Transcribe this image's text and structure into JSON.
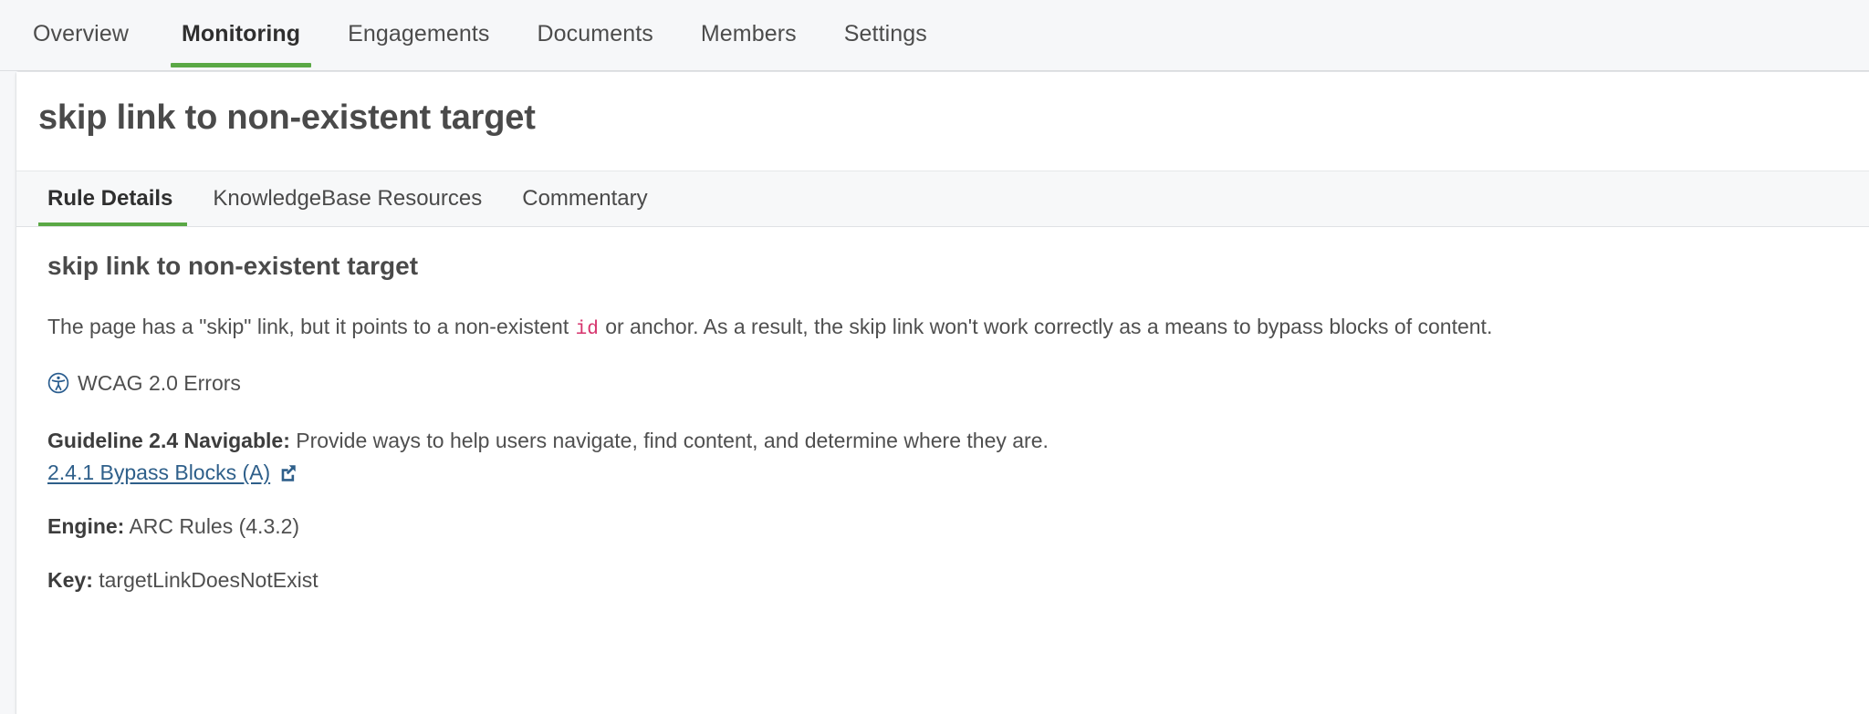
{
  "top_nav": {
    "tabs": [
      {
        "label": "Overview",
        "active": false
      },
      {
        "label": "Monitoring",
        "active": true
      },
      {
        "label": "Engagements",
        "active": false
      },
      {
        "label": "Documents",
        "active": false
      },
      {
        "label": "Members",
        "active": false
      },
      {
        "label": "Settings",
        "active": false
      }
    ]
  },
  "card": {
    "title": "skip link to non-existent target",
    "tabs": [
      {
        "label": "Rule Details",
        "active": true
      },
      {
        "label": "KnowledgeBase Resources",
        "active": false
      },
      {
        "label": "Commentary",
        "active": false
      }
    ]
  },
  "rule": {
    "name": "skip link to non-existent target",
    "description_before_code": "The page has a \"skip\" link, but it points to a non-existent ",
    "description_code": "id",
    "description_after_code": " or anchor. As a result, the skip link won't work correctly as a means to bypass blocks of content.",
    "standard_icon": "accessibility-icon",
    "standard_label": "WCAG 2.0 Errors",
    "guideline_label": "Guideline 2.4 Navigable:",
    "guideline_text": " Provide ways to help users navigate, find content, and determine where they are.",
    "success_criterion_link": "2.4.1 Bypass Blocks (A)",
    "external_link_icon": "external-link-icon",
    "engine_label": "Engine:",
    "engine_value": " ARC Rules (4.3.2)",
    "key_label": "Key:",
    "key_value": " targetLinkDoesNotExist"
  },
  "colors": {
    "accent_green": "#5aa845",
    "link_blue": "#2e5f8a",
    "code_pink": "#d6336c",
    "page_background": "#f6f7f9",
    "card_background": "#ffffff"
  }
}
